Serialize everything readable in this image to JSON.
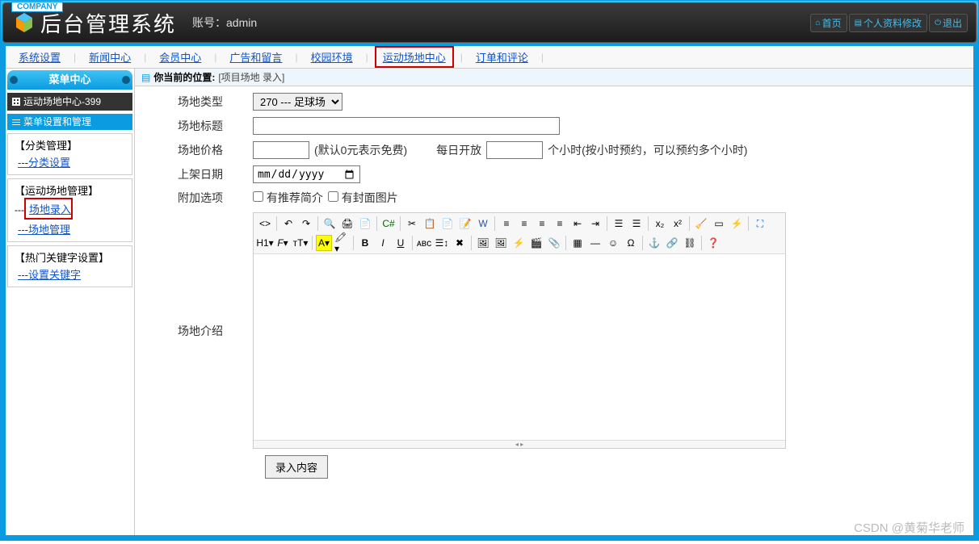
{
  "brand_badge": "COMPANY",
  "app_title": "后台管理系统",
  "account_label": "账号：",
  "account_value": "admin",
  "top_links": {
    "home": "首页",
    "profile": "个人资料修改",
    "logout": "退出"
  },
  "tabs": [
    "系统设置",
    "新闻中心",
    "会员中心",
    "广告和留言",
    "校园环境",
    "运动场地中心",
    "订单和评论"
  ],
  "active_tab_index": 5,
  "sidebar": {
    "header": "菜单中心",
    "panel_title": "运动场地中心-399",
    "sub_title": "菜单设置和管理",
    "groups": [
      {
        "title": "【分类管理】",
        "items": [
          {
            "label": "分类设置",
            "active": false
          }
        ]
      },
      {
        "title": "【运动场地管理】",
        "items": [
          {
            "label": "场地录入",
            "active": true
          },
          {
            "label": "场地管理",
            "active": false
          }
        ]
      },
      {
        "title": "【热门关键字设置】",
        "items": [
          {
            "label": "设置关键字",
            "active": false
          }
        ]
      }
    ]
  },
  "breadcrumb": {
    "label": "你当前的位置:",
    "location": "[项目场地 录入]"
  },
  "form": {
    "type_label": "场地类型",
    "type_value": "270 --- 足球场",
    "title_label": "场地标题",
    "title_value": "",
    "price_label": "场地价格",
    "price_value": "",
    "price_hint": "(默认0元表示免费)",
    "daily_open_label": "每日开放",
    "daily_hours_value": "",
    "hours_hint": "个小时(按小时预约，可以预约多个小时)",
    "date_label": "上架日期",
    "date_placeholder": "年 /月/日",
    "extras_label": "附加选项",
    "extras_option1": "有推荐简介",
    "extras_option2": "有封面图片",
    "intro_label": "场地介绍",
    "submit_label": "录入内容"
  },
  "watermark": "CSDN @黄菊华老师"
}
